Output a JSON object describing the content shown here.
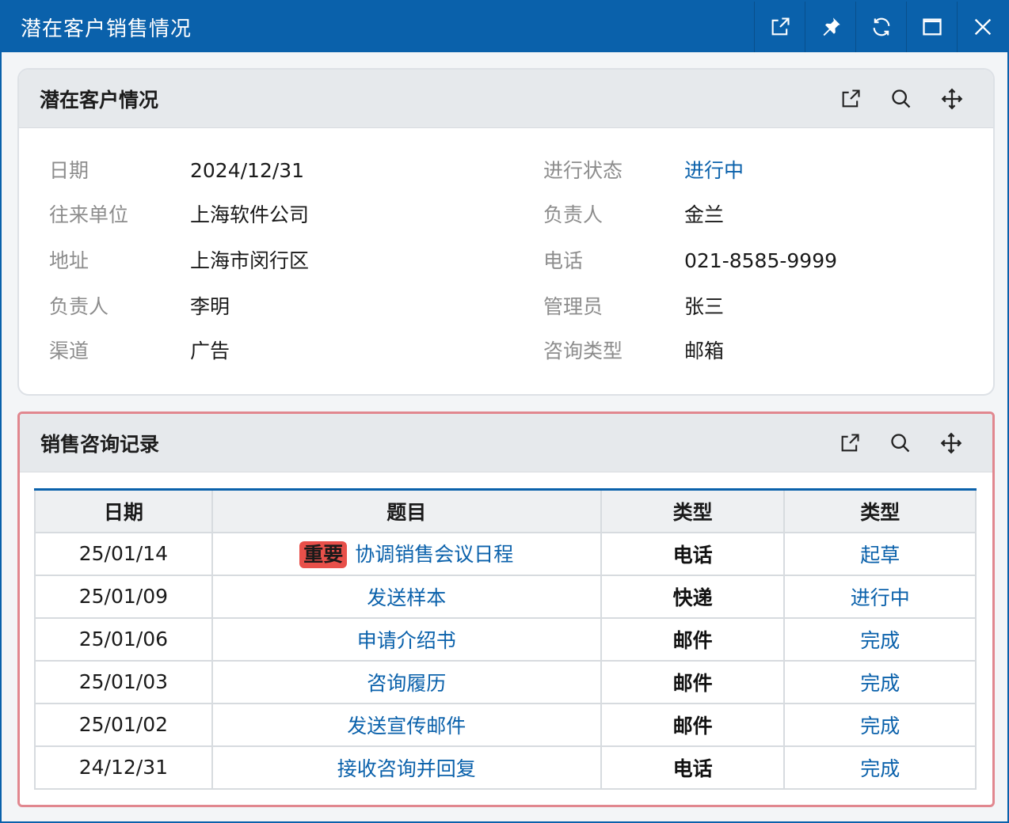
{
  "window": {
    "title": "潜在客户销售情况",
    "accent": "#0a61ab",
    "controls": [
      "open-external-icon",
      "pin-icon",
      "refresh-icon",
      "maximize-icon",
      "close-icon"
    ]
  },
  "info_panel": {
    "title": "潜在客户情况",
    "icons": [
      "open-external-icon",
      "search-icon",
      "move-icon"
    ],
    "left": [
      {
        "label": "日期",
        "value": "2024/12/31"
      },
      {
        "label": "往来单位",
        "value": "上海软件公司"
      },
      {
        "label": "地址",
        "value": "上海市闵行区"
      },
      {
        "label": "负责人",
        "value": "李明"
      },
      {
        "label": "渠道",
        "value": "广告"
      }
    ],
    "right": [
      {
        "label": "进行状态",
        "value": "进行中"
      },
      {
        "label": "负责人",
        "value": "金兰"
      },
      {
        "label": "电话",
        "value": "021-8585-9999"
      },
      {
        "label": "管理员",
        "value": "张三"
      },
      {
        "label": "咨询类型",
        "value": "邮箱"
      }
    ]
  },
  "records_panel": {
    "title": "销售咨询记录",
    "icons": [
      "open-external-icon",
      "search-icon",
      "move-icon"
    ],
    "columns": [
      "日期",
      "题目",
      "类型",
      "类型"
    ],
    "rows": [
      {
        "date": "25/01/14",
        "badge": "重要",
        "subject": "协调销售会议日程",
        "type": "电话",
        "status": "起草"
      },
      {
        "date": "25/01/09",
        "badge": "",
        "subject": "发送样本",
        "type": "快递",
        "status": "进行中"
      },
      {
        "date": "25/01/06",
        "badge": "",
        "subject": "申请介绍书",
        "type": "邮件",
        "status": "完成"
      },
      {
        "date": "25/01/03",
        "badge": "",
        "subject": "咨询履历",
        "type": "邮件",
        "status": "完成"
      },
      {
        "date": "25/01/02",
        "badge": "",
        "subject": "发送宣传邮件",
        "type": "邮件",
        "status": "完成"
      },
      {
        "date": "24/12/31",
        "badge": "",
        "subject": "接收咨询并回复",
        "type": "电话",
        "status": "完成"
      }
    ]
  }
}
